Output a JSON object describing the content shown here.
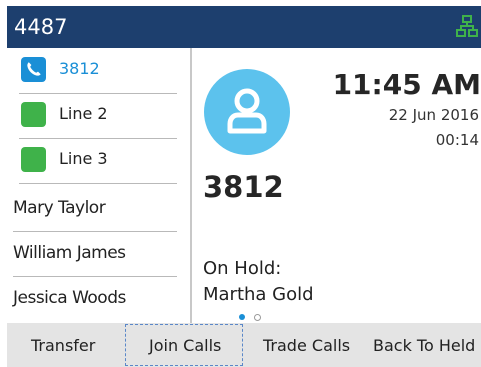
{
  "header": {
    "extension": "4487",
    "network_icon": "network-connected-icon",
    "network_color": "#3fb24a"
  },
  "colors": {
    "topbar": "#1d3f6e",
    "accent": "#1a8fd6",
    "line_green": "#3fb24a",
    "avatar": "#5cc2ed",
    "softkey_bar": "#e4e4e4"
  },
  "sidebar": {
    "lines": [
      {
        "label": "3812",
        "icon": "handset-icon",
        "state": "active"
      },
      {
        "label": "Line 2",
        "icon": "line-status-icon",
        "state": "idle"
      },
      {
        "label": "Line 3",
        "icon": "line-status-icon",
        "state": "idle"
      }
    ],
    "contacts": [
      {
        "label": "Mary Taylor"
      },
      {
        "label": "William James"
      },
      {
        "label": "Jessica Woods"
      }
    ]
  },
  "call": {
    "avatar_icon": "contact-avatar-icon",
    "time": "11:45 AM",
    "date": "22 Jun 2016",
    "duration": "00:14",
    "number": "3812",
    "hold_label": "On Hold:",
    "hold_name": "Martha Gold",
    "page_indicator": {
      "pages": 2,
      "current": 1
    }
  },
  "softkeys": [
    {
      "label": "Transfer"
    },
    {
      "label": "Join Calls",
      "focused": true
    },
    {
      "label": "Trade Calls"
    },
    {
      "label": "Back To Held"
    }
  ]
}
